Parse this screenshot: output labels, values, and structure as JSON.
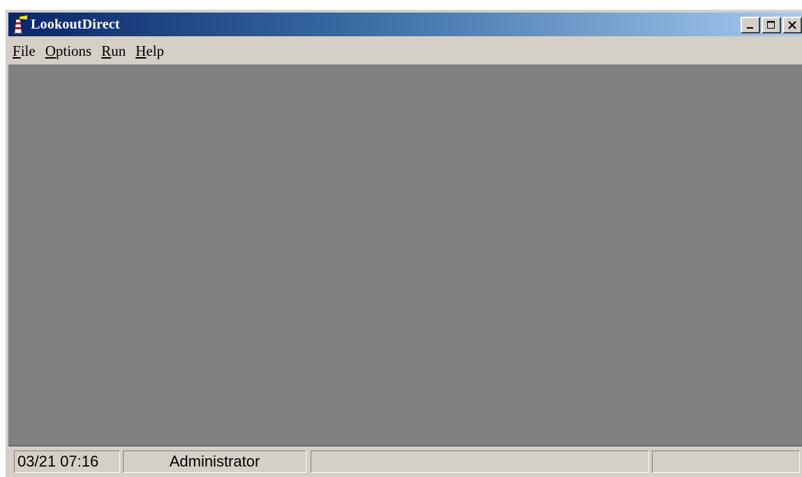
{
  "window": {
    "title": "LookoutDirect",
    "icon": "lighthouse-icon",
    "caption_buttons": [
      "minimize-icon",
      "maximize-icon",
      "close-icon"
    ]
  },
  "menu": {
    "items": [
      {
        "label_accel": "F",
        "label_rest": "ile"
      },
      {
        "label_accel": "O",
        "label_rest": "ptions"
      },
      {
        "label_accel": "R",
        "label_rest": "un"
      },
      {
        "label_accel": "H",
        "label_rest": "elp"
      }
    ]
  },
  "client": {
    "background": "#808080"
  },
  "statusbar": {
    "datetime": "03/21 07:16",
    "user": "Administrator",
    "panel3": "",
    "panel4": ""
  },
  "colors": {
    "titlebar_start": "#0a246a",
    "titlebar_end": "#a6caf0",
    "face": "#d4d0c8"
  }
}
